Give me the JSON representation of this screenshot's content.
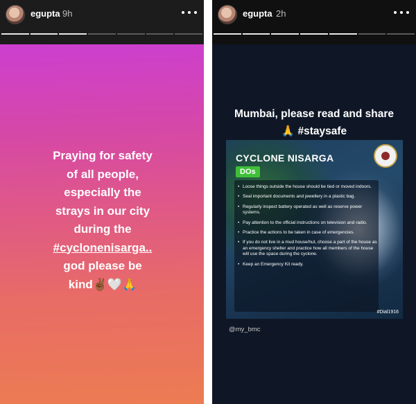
{
  "left_story": {
    "username": "egupta",
    "time": "9h",
    "text_lines": [
      "Praying for safety",
      "of all people,",
      "especially the",
      "strays in our city",
      "during the",
      "#cyclonenisarga..",
      "god please be",
      "kind✌🏾🤍🙏"
    ]
  },
  "right_story": {
    "username": "egupta",
    "time": "2h",
    "headline": "Mumbai, please read and share",
    "tag_line": "🙏 #staysafe",
    "poster": {
      "title": "CYCLONE NISARGA",
      "badge": "DOs",
      "items": [
        "Loose things outside the house should be tied or moved indoors.",
        "Seal important documents and jewellery in a plastic bag.",
        "Regularly inspect battery operated as well as reserve power systems.",
        "Pay attention to the official instructions on television and radio.",
        "Practice the actions to be taken in case of emergencies.",
        "If you do not live in a mud house/hut, choose a part of the house as an emergency shelter and practice how all members of the house will use the space during the cyclone.",
        "Keep an Emergency Kit ready."
      ],
      "tag": "#Dial1916"
    },
    "credit": "@my_bmc"
  },
  "icons": {
    "more": "more-horizontal-icon",
    "avatar": "profile-avatar"
  }
}
